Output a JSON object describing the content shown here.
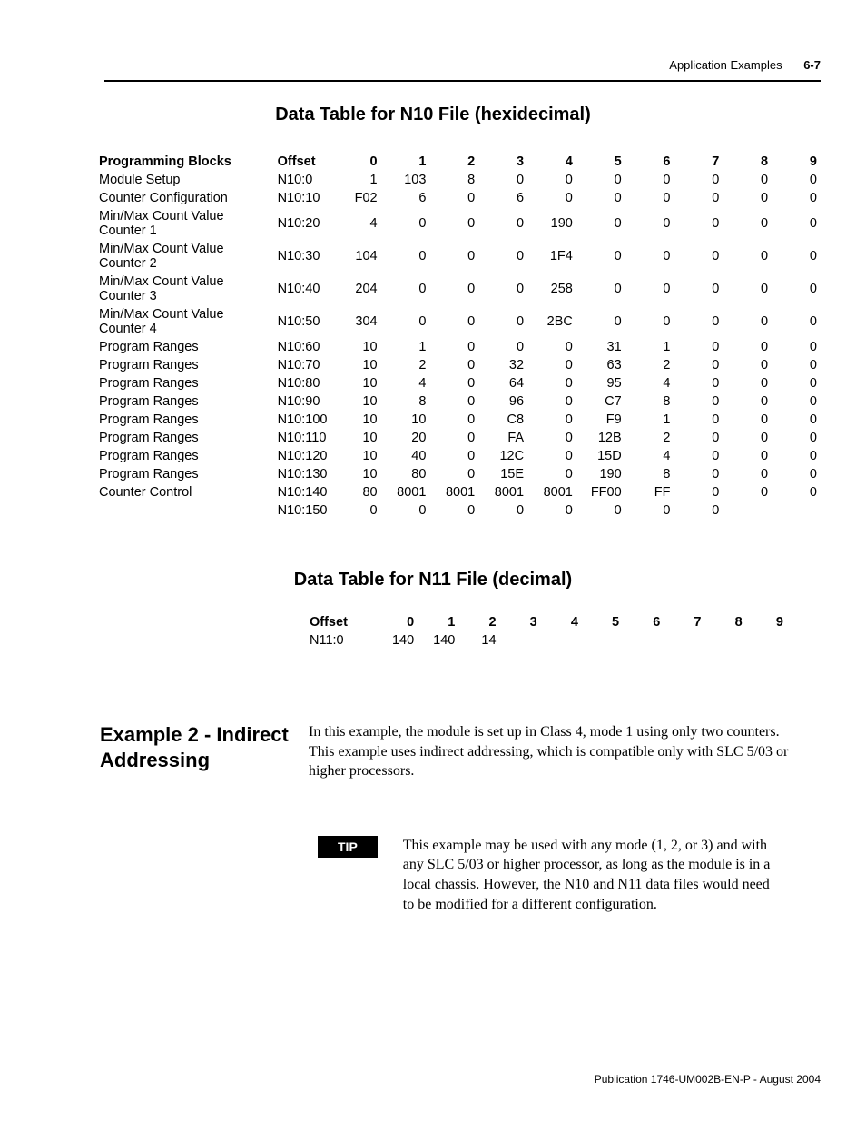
{
  "header": {
    "section": "Application Examples",
    "page": "6-7"
  },
  "table1": {
    "title": "Data Table for N10 File (hexidecimal)",
    "headers": [
      "Programming Blocks",
      "Offset",
      "0",
      "1",
      "2",
      "3",
      "4",
      "5",
      "6",
      "7",
      "8",
      "9"
    ],
    "rows": [
      [
        "Module Setup",
        "N10:0",
        "1",
        "103",
        "8",
        "0",
        "0",
        "0",
        "0",
        "0",
        "0",
        "0"
      ],
      [
        "Counter Configuration",
        "N10:10",
        "F02",
        "6",
        "0",
        "6",
        "0",
        "0",
        "0",
        "0",
        "0",
        "0"
      ],
      [
        "Min/Max Count Value Counter 1",
        "N10:20",
        "4",
        "0",
        "0",
        "0",
        "190",
        "0",
        "0",
        "0",
        "0",
        "0"
      ],
      [
        "Min/Max Count Value Counter 2",
        "N10:30",
        "104",
        "0",
        "0",
        "0",
        "1F4",
        "0",
        "0",
        "0",
        "0",
        "0"
      ],
      [
        "Min/Max Count Value Counter 3",
        "N10:40",
        "204",
        "0",
        "0",
        "0",
        "258",
        "0",
        "0",
        "0",
        "0",
        "0"
      ],
      [
        "Min/Max Count Value Counter 4",
        "N10:50",
        "304",
        "0",
        "0",
        "0",
        "2BC",
        "0",
        "0",
        "0",
        "0",
        "0"
      ],
      [
        "Program Ranges",
        "N10:60",
        "10",
        "1",
        "0",
        "0",
        "0",
        "31",
        "1",
        "0",
        "0",
        "0"
      ],
      [
        "Program Ranges",
        "N10:70",
        "10",
        "2",
        "0",
        "32",
        "0",
        "63",
        "2",
        "0",
        "0",
        "0"
      ],
      [
        "Program Ranges",
        "N10:80",
        "10",
        "4",
        "0",
        "64",
        "0",
        "95",
        "4",
        "0",
        "0",
        "0"
      ],
      [
        "Program Ranges",
        "N10:90",
        "10",
        "8",
        "0",
        "96",
        "0",
        "C7",
        "8",
        "0",
        "0",
        "0"
      ],
      [
        "Program Ranges",
        "N10:100",
        "10",
        "10",
        "0",
        "C8",
        "0",
        "F9",
        "1",
        "0",
        "0",
        "0"
      ],
      [
        "Program Ranges",
        "N10:110",
        "10",
        "20",
        "0",
        "FA",
        "0",
        "12B",
        "2",
        "0",
        "0",
        "0"
      ],
      [
        "Program Ranges",
        "N10:120",
        "10",
        "40",
        "0",
        "12C",
        "0",
        "15D",
        "4",
        "0",
        "0",
        "0"
      ],
      [
        "Program Ranges",
        "N10:130",
        "10",
        "80",
        "0",
        "15E",
        "0",
        "190",
        "8",
        "0",
        "0",
        "0"
      ],
      [
        "Counter Control",
        "N10:140",
        "80",
        "8001",
        "8001",
        "8001",
        "8001",
        "FF00",
        "FF",
        "0",
        "0",
        "0"
      ],
      [
        "",
        "N10:150",
        "0",
        "0",
        "0",
        "0",
        "0",
        "0",
        "0",
        "0",
        "",
        ""
      ]
    ]
  },
  "table2": {
    "title": "Data Table for N11 File (decimal)",
    "headers": [
      "Offset",
      "0",
      "1",
      "2",
      "3",
      "4",
      "5",
      "6",
      "7",
      "8",
      "9"
    ],
    "row": [
      "N11:0",
      "140",
      "140",
      "14",
      "",
      "",
      "",
      "",
      "",
      "",
      ""
    ]
  },
  "example": {
    "heading": "Example 2 - Indirect Addressing",
    "body": "In this example, the module is set up in Class 4, mode 1 using only two counters. This example uses indirect addressing, which is compatible only with SLC 5/03 or higher processors."
  },
  "tip": {
    "label": "TIP",
    "text": "This example may be used with any mode (1, 2, or 3) and with any SLC 5/03 or higher processor, as long as the module is in a local chassis. However, the N10 and N11 data files would need to be modified for a different configuration."
  },
  "footer": "Publication 1746-UM002B-EN-P - August 2004"
}
